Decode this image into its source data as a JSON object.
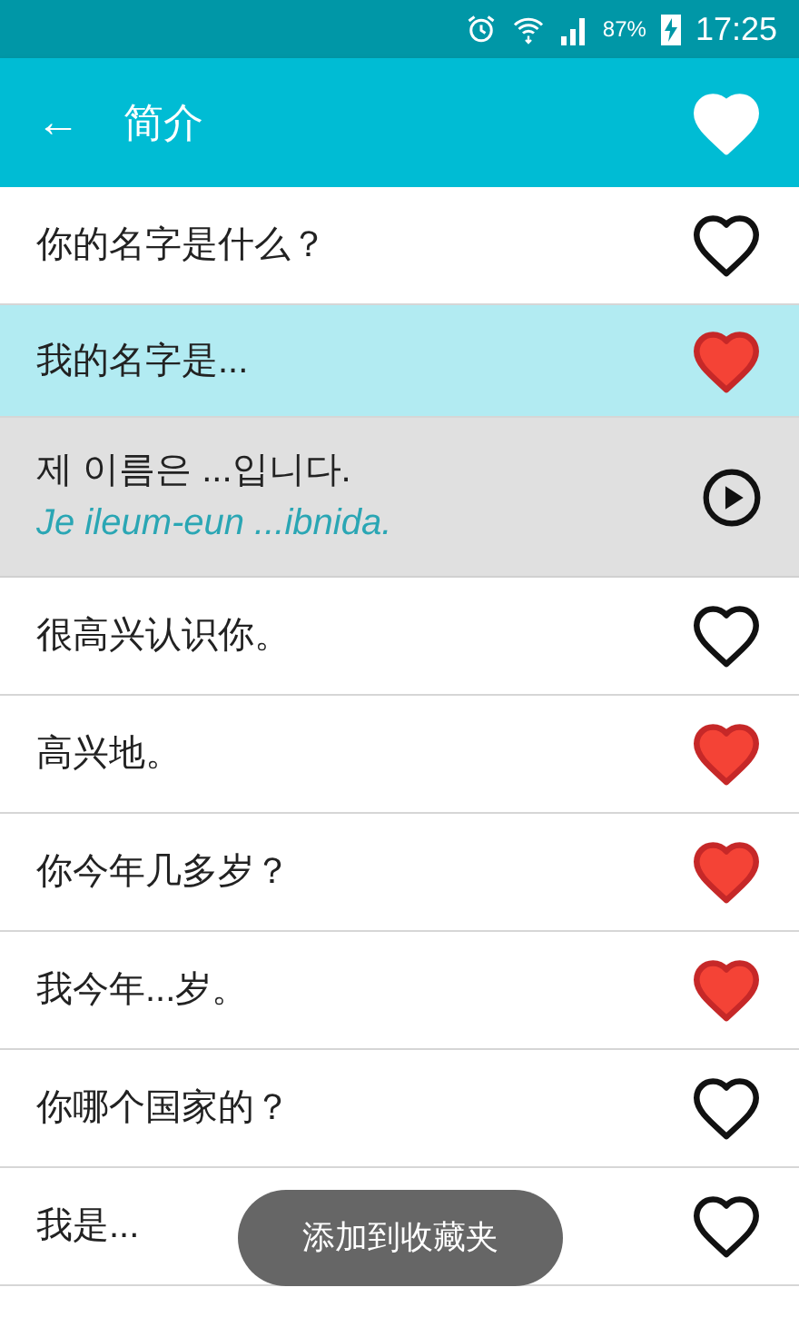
{
  "status_bar": {
    "battery": "87%",
    "time": "17:25"
  },
  "app_bar": {
    "back": "←",
    "title": "简介",
    "favorite": true
  },
  "rows": [
    {
      "kind": "phrase",
      "text": "你的名字是什么？",
      "favorite": false,
      "selected": false
    },
    {
      "kind": "phrase",
      "text": "我的名字是...",
      "favorite": true,
      "selected": true
    },
    {
      "kind": "translation",
      "text": "제 이름은 ...입니다.",
      "romanization": "Je ileum-eun ...ibnida."
    },
    {
      "kind": "phrase",
      "text": "很高兴认识你。",
      "favorite": false,
      "selected": false
    },
    {
      "kind": "phrase",
      "text": "高兴地。",
      "favorite": true,
      "selected": false
    },
    {
      "kind": "phrase",
      "text": "你今年几多岁？",
      "favorite": true,
      "selected": false
    },
    {
      "kind": "phrase",
      "text": "我今年...岁。",
      "favorite": true,
      "selected": false
    },
    {
      "kind": "phrase",
      "text": "你哪个国家的？",
      "favorite": false,
      "selected": false
    },
    {
      "kind": "phrase",
      "text": "我是...",
      "favorite": false,
      "selected": false
    }
  ],
  "toast": "添加到收藏夹"
}
